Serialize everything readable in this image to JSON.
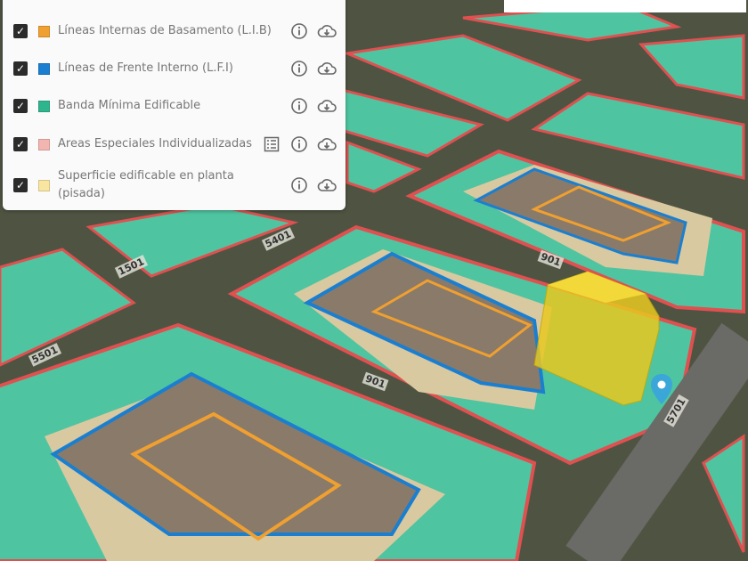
{
  "legend": {
    "layers": [
      {
        "label": "Líneas Internas de Basamento (L.I.B)",
        "color": "#f0a030",
        "checked": true,
        "has_table": false
      },
      {
        "label": "Líneas de Frente Interno (L.F.I)",
        "color": "#1a7fd0",
        "checked": true,
        "has_table": false
      },
      {
        "label": "Banda Mínima Edificable",
        "color": "#2fb58e",
        "checked": true,
        "has_table": false
      },
      {
        "label": "Areas Especiales Individualizadas",
        "color": "#f3b5b0",
        "checked": true,
        "has_table": true
      },
      {
        "label": "Superficie edificable en planta (pisada)",
        "color": "#f8e6a0",
        "checked": true,
        "has_table": false
      }
    ]
  },
  "map": {
    "street_labels": [
      "5501",
      "901",
      "901",
      "5701",
      "1501",
      "5401"
    ],
    "colors": {
      "band": "#4fc4a0",
      "border": "#e05050",
      "lfi": "#1a7fd0",
      "lib": "#f0a030",
      "building": "#e8c820",
      "pin": "#3aa7d8"
    }
  }
}
